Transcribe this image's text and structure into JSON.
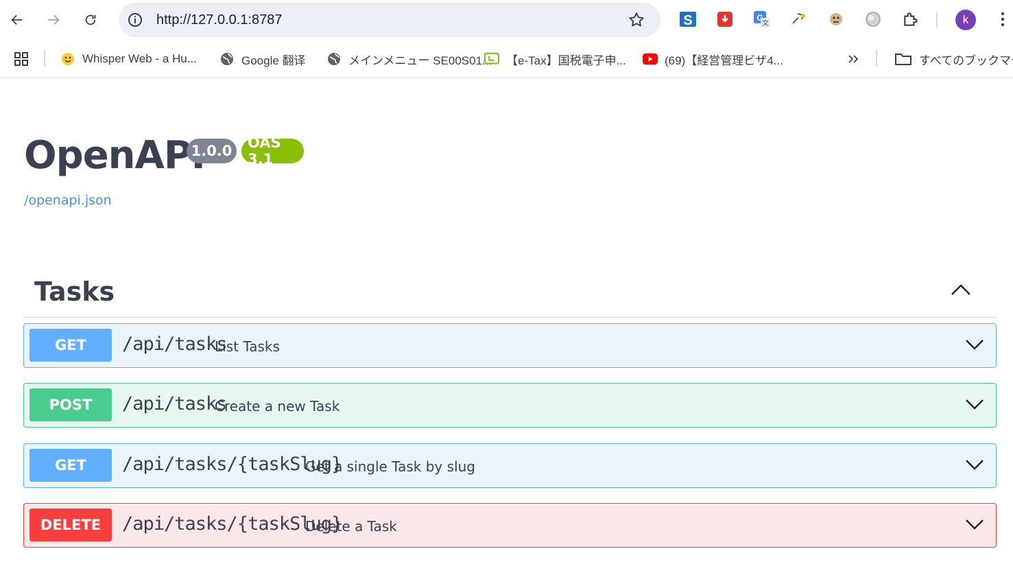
{
  "browser": {
    "url": "http://127.0.0.1:8787",
    "profile_initial": "k",
    "bookmarks": [
      {
        "label": "Whisper Web - a Hu...",
        "icon": "hugging-face-icon"
      },
      {
        "label": "Google 翻译",
        "icon": "globe-icon"
      },
      {
        "label": "メインメニュー SE00S01...",
        "icon": "globe-icon"
      },
      {
        "label": "【e-Tax】国税電子申...",
        "icon": "etax-icon"
      },
      {
        "label": "(69)【経営管理ビザ4...",
        "icon": "youtube-icon"
      }
    ],
    "all_bookmarks_label": "すべてのブックマーク"
  },
  "info": {
    "title": "OpenAPI",
    "version": "1.0.0",
    "oas": "OAS 3.1",
    "spec_link": "/openapi.json"
  },
  "tag": {
    "name": "Tasks",
    "operations": [
      {
        "method": "GET",
        "path": "/api/tasks",
        "summary": "List Tasks"
      },
      {
        "method": "POST",
        "path": "/api/tasks",
        "summary": "Create a new Task"
      },
      {
        "method": "GET",
        "path": "/api/tasks/{taskSlug}",
        "summary": "Get a single Task by slug"
      },
      {
        "method": "DELETE",
        "path": "/api/tasks/{taskSlug}",
        "summary": "Delete a Task"
      }
    ]
  },
  "colors": {
    "get": "#61affe",
    "post": "#49cc90",
    "delete": "#f93e3e",
    "version_badge": "#7d8492",
    "oas_badge": "#89bf04",
    "link": "#4990e2"
  }
}
